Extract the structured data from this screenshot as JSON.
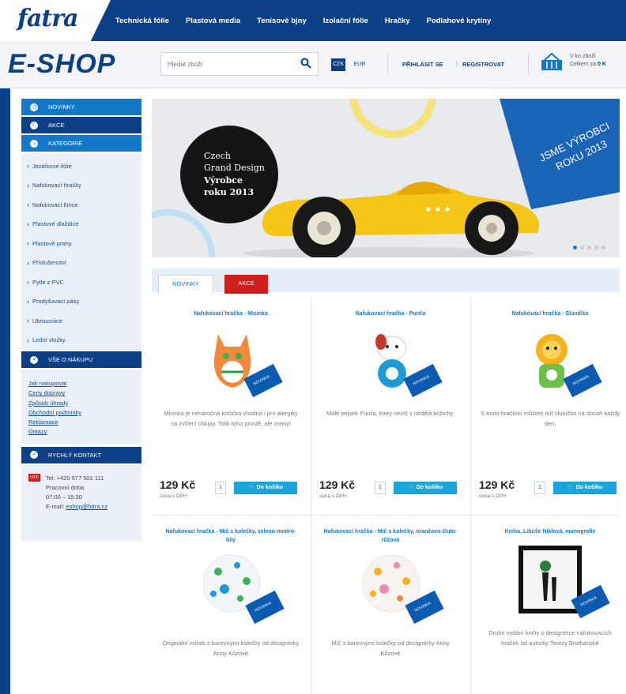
{
  "brand": {
    "logo": "fatra",
    "shop": "E-SHOP"
  },
  "topnav": [
    "Technická fólie",
    "Plastová media",
    "Tenisové bjny",
    "Izolační fólie",
    "Hračky",
    "Podlahové krytiny"
  ],
  "header": {
    "search_placeholder": "Hledat zboží",
    "currency_active": "CZK",
    "currency_other": "EUR",
    "login": "PŘIHLÁSIT SE",
    "separator": "|",
    "register": "REGISTROVAT",
    "basket_line1": "V ko zboží",
    "basket_line2": "Celkem za",
    "basket_value": "0 K"
  },
  "sidebar": {
    "sections": {
      "news": "NOVINKY",
      "promo": "AKCE",
      "categories": "KATEGORIE",
      "shopping": "VŠE O NÁKUPU",
      "contact": "RYCHLÝ KONTAKT"
    },
    "categories": [
      "Jezdíkové fólie",
      "Nafukovací hračky",
      "Nafukovací lhnce",
      "Plastové dlaždice",
      "Plastové prahy",
      "Příslušenství",
      "Pytle z PVC",
      "Prodyšovací pásy",
      "Ubrousnice",
      "Lední vložky"
    ],
    "info_links": [
      "Jak nakupovat",
      "Ceny dopravy",
      "Způsob úhrady",
      "Obchodní podmínky",
      "Reklamace",
      "Dotazy"
    ],
    "contact_badge": "OFF",
    "contact_lines": [
      "Tel: +420 577 501 111",
      "Pracovní doba",
      "07:00 – 15:30",
      "E-mail:"
    ],
    "contact_email": "eshop@fatra.cz"
  },
  "banner": {
    "badge_lines": [
      "Czech",
      "Grand Design",
      "Výrobce",
      "roku 2013"
    ],
    "flag_line1": "JSME VÝROBCI",
    "flag_line2": "ROKU 2013"
  },
  "tabs": {
    "news": "NOVINKY",
    "promo": "AKCE"
  },
  "products": [
    {
      "name": "Nafukovací hračka - Micinka",
      "desc": "Micinka je nenáročná kočička vhodná i pro alergiky na zvířecí chlupy. Tolik toho prostě, ale zvaný!",
      "price": "129 Kč",
      "tax": "cena s DPH",
      "qty": "1",
      "button": "Do košíku"
    },
    {
      "name": "Nafukovací hračka - Punťa",
      "desc": "Malé pejsek Punťa, který nevíš s nedělá kožichy.",
      "price": "129 Kč",
      "tax": "cena s DPH",
      "qty": "1",
      "button": "Do košíku"
    },
    {
      "name": "Nafukovací hračka - Sluníčko",
      "desc": "S touto hračkou můžete mít sluníčko na dosah každý den.",
      "price": "129 Kč",
      "tax": "cena s DPH",
      "qty": "1",
      "button": "Do košíku"
    },
    {
      "name": "Nafukovací hračka - Míč s kolečky, zeleno-modro-bílý",
      "desc": "Originální míček s barevnými kolečky od designérky Anny Kůzové"
    },
    {
      "name": "Nafukovací hračka - Míč s kolečky, oranžovo-žluto-růžová",
      "desc": "Míč s barevnými kolečky od designérky Anny Kůzové"
    },
    {
      "name": "Kniha, Libuše Niklová, monografie",
      "desc": "Druhé vydání knihy o designérce nafukovacích hraček od autorky Terezy Brothanské"
    }
  ],
  "new_tag": "NOVINKA"
}
